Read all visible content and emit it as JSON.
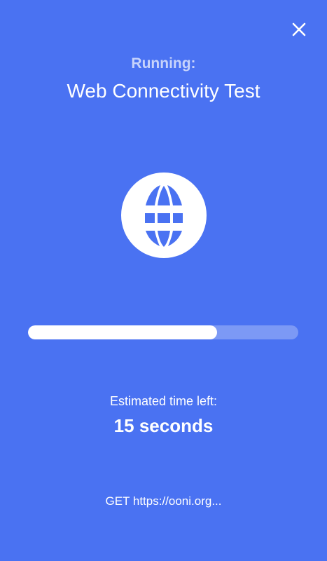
{
  "header": {
    "close_icon": "close-icon",
    "running_label": "Running:",
    "test_name": "Web Connectivity Test"
  },
  "test_icon": "globe-icon",
  "progress": {
    "fraction": 0.7
  },
  "eta": {
    "label": "Estimated time left:",
    "value": "15 seconds"
  },
  "log": {
    "line": "GET https://ooni.org..."
  },
  "colors": {
    "background": "#4a72f2",
    "running_label": "#c7d3fb",
    "progress_fill": "#ffffff",
    "progress_track": "rgba(255,255,255,0.28)"
  }
}
